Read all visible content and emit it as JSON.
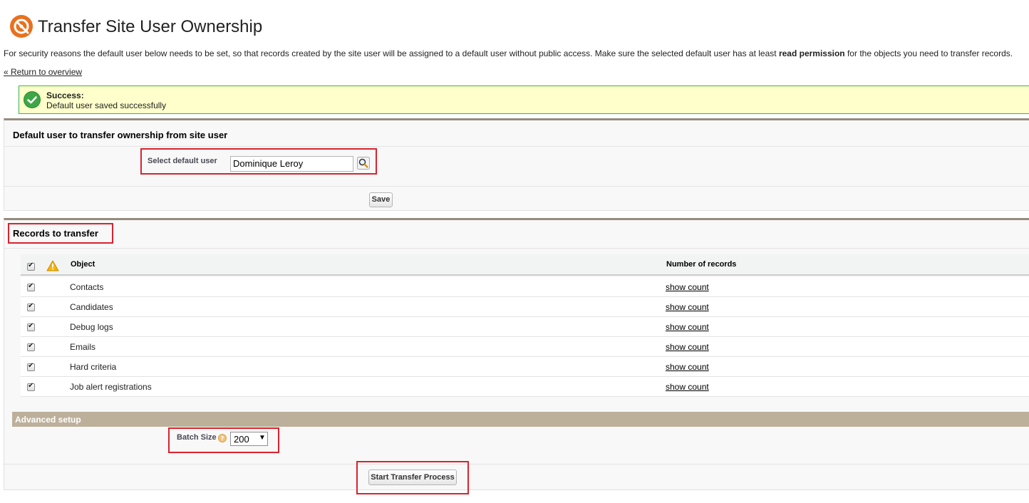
{
  "header": {
    "title": "Transfer Site User Ownership",
    "intro_pre": "For security reasons the default user below needs to be set, so that records created by the site user will be assigned to a default user without public access. Make sure the selected default user has at least ",
    "intro_bold": "read permission",
    "intro_post": " for the objects you need to transfer records.",
    "back_link": "« Return to overview"
  },
  "message": {
    "title": "Success:",
    "text": "Default user saved successfully"
  },
  "default_user": {
    "section_title": "Default user to transfer ownership from site user",
    "field_label": "Select default user",
    "value": "Dominique Leroy",
    "save_label": "Save"
  },
  "records": {
    "section_title": "Records to transfer",
    "columns": {
      "object": "Object",
      "count": "Number of records"
    },
    "rows": [
      {
        "object": "Contacts",
        "count_link": "show count",
        "checked": true
      },
      {
        "object": "Candidates",
        "count_link": "show count",
        "checked": true
      },
      {
        "object": "Debug logs",
        "count_link": "show count",
        "checked": true
      },
      {
        "object": "Emails",
        "count_link": "show count",
        "checked": true
      },
      {
        "object": "Hard criteria",
        "count_link": "show count",
        "checked": true
      },
      {
        "object": "Job alert registrations",
        "count_link": "show count",
        "checked": true
      }
    ]
  },
  "advanced": {
    "title": "Advanced setup",
    "batch_label": "Batch Size",
    "batch_value": "200",
    "start_label": "Start Transfer Process"
  },
  "colors": {
    "brand_orange": "#e8711f",
    "success_green": "#3fa646",
    "message_bg": "#ffffcc",
    "highlight_red": "#d9232d",
    "advanced_bar": "#bdb09b"
  }
}
